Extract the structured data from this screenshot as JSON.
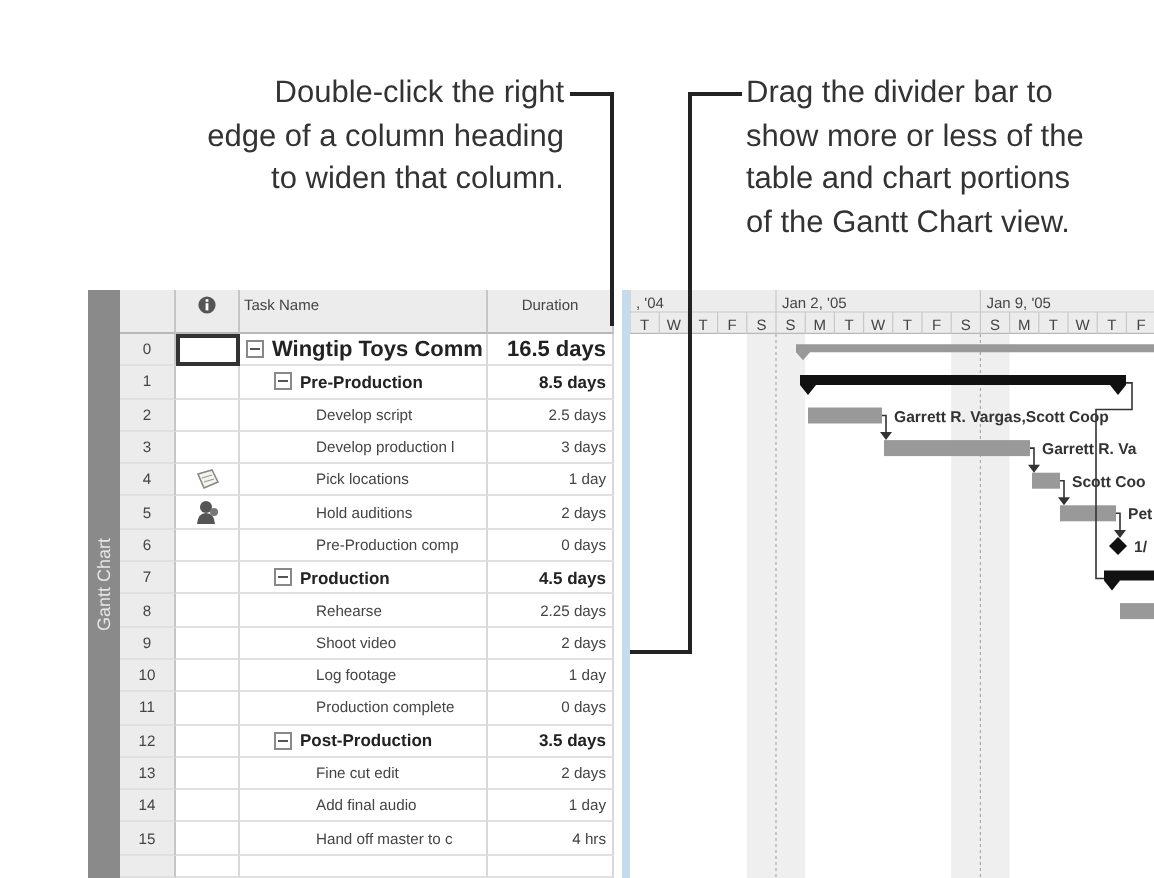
{
  "callouts": [
    {
      "text": "Double-click the right\nedge of a column heading\nto widen that column."
    },
    {
      "text": "Drag the divider bar to\nshow more or less of the\ntable and chart portions\nof the Gantt Chart view."
    }
  ],
  "view_bar": {
    "label": "Gantt Chart"
  },
  "table": {
    "columns": [
      "Task Name",
      "Duration"
    ],
    "tasks": [
      {
        "id": "0",
        "name": "Wingtip Toys Comm",
        "duration": "16.5 days",
        "selected": true,
        "expanded": true,
        "children": [
          {
            "id": "1",
            "name": "Pre-Production",
            "duration": "8.5 days",
            "selected": false,
            "expanded": true,
            "children": [
              {
                "id": "2",
                "name": "Develop script",
                "duration": "2.5 days",
                "selected": false,
                "resources": "Garrett R. Vargas,Scott Coop"
              },
              {
                "id": "3",
                "name": "Develop production l",
                "duration": "3 days",
                "selected": false,
                "resources": "Garrett R. Va"
              },
              {
                "id": "4",
                "name": "Pick locations",
                "duration": "1 day",
                "selected": false,
                "kind": "note",
                "resources": "Scott Coo"
              },
              {
                "id": "5",
                "name": "Hold auditions",
                "duration": "2 days",
                "selected": false,
                "kind": "person",
                "resources": "Pet"
              },
              {
                "id": "6",
                "name": "Pre-Production comp",
                "duration": "0 days",
                "selected": false,
                "resources": "1/"
              }
            ]
          },
          {
            "id": "7",
            "name": "Production",
            "duration": "4.5 days",
            "selected": false,
            "expanded": true,
            "children": [
              {
                "id": "8",
                "name": "Rehearse",
                "duration": "2.25 days",
                "selected": false
              },
              {
                "id": "9",
                "name": "Shoot video",
                "duration": "2 days",
                "selected": false
              },
              {
                "id": "10",
                "name": "Log footage",
                "duration": "1 day",
                "selected": false
              },
              {
                "id": "11",
                "name": "Production complete",
                "duration": "0 days",
                "selected": false
              }
            ]
          },
          {
            "id": "12",
            "name": "Post-Production",
            "duration": "3.5 days",
            "selected": false,
            "expanded": true,
            "children": [
              {
                "id": "13",
                "name": "Fine cut edit",
                "duration": "2 days",
                "selected": false
              },
              {
                "id": "14",
                "name": "Add final audio",
                "duration": "1 day",
                "selected": false
              },
              {
                "id": "15",
                "name": "Hand off master to c",
                "duration": "4 hrs",
                "selected": false
              }
            ]
          }
        ]
      }
    ]
  },
  "timescale": {
    "weeks": [
      ", '04",
      "Jan 2, '05",
      "Jan 9, '05"
    ],
    "days": [
      "T",
      "W",
      "T",
      "F",
      "S",
      "S",
      "M",
      "T",
      "W",
      "T",
      "F",
      "S",
      "S",
      "M",
      "T",
      "W",
      "T",
      "F"
    ]
  }
}
